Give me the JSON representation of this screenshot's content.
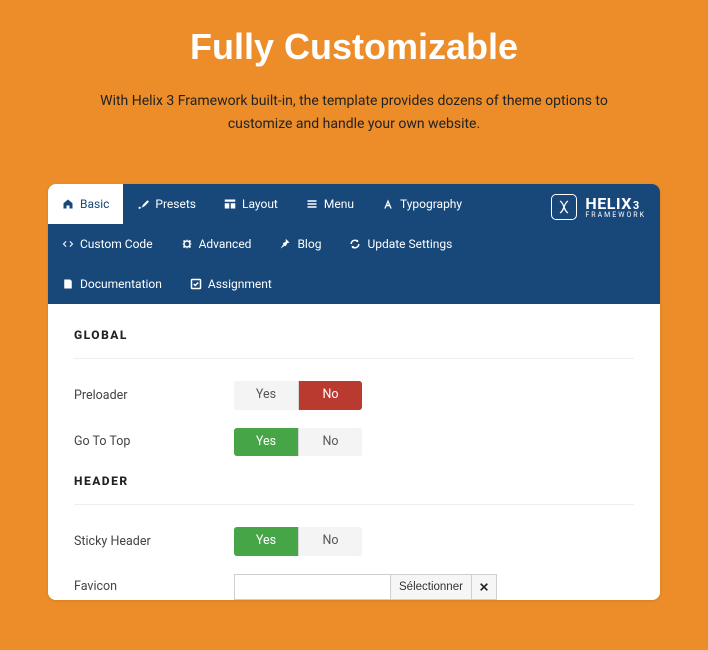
{
  "hero": {
    "title": "Fully Customizable",
    "description": "With Helix 3 Framework built-in, the template provides dozens of theme options to customize and handle your own website."
  },
  "brand": {
    "name_main": "HELIX",
    "name_suffix": "3",
    "sub": "FRAMEWORK"
  },
  "nav": {
    "items": [
      {
        "label": "Basic",
        "icon": "home"
      },
      {
        "label": "Presets",
        "icon": "brush"
      },
      {
        "label": "Layout",
        "icon": "grid"
      },
      {
        "label": "Menu",
        "icon": "list"
      },
      {
        "label": "Typography",
        "icon": "font"
      },
      {
        "label": "Custom Code",
        "icon": "code"
      },
      {
        "label": "Advanced",
        "icon": "gear"
      },
      {
        "label": "Blog",
        "icon": "pin"
      },
      {
        "label": "Update Settings",
        "icon": "refresh"
      },
      {
        "label": "Documentation",
        "icon": "book"
      },
      {
        "label": "Assignment",
        "icon": "check"
      }
    ],
    "active_index": 0
  },
  "sections": {
    "global": {
      "title": "GLOBAL",
      "preloader": {
        "label": "Preloader",
        "yes": "Yes",
        "no": "No",
        "value": "No"
      },
      "gototop": {
        "label": "Go To Top",
        "yes": "Yes",
        "no": "No",
        "value": "Yes"
      }
    },
    "header": {
      "title": "HEADER",
      "sticky": {
        "label": "Sticky Header",
        "yes": "Yes",
        "no": "No",
        "value": "Yes"
      },
      "favicon": {
        "label": "Favicon",
        "select_label": "Sélectionner",
        "value": ""
      }
    }
  }
}
